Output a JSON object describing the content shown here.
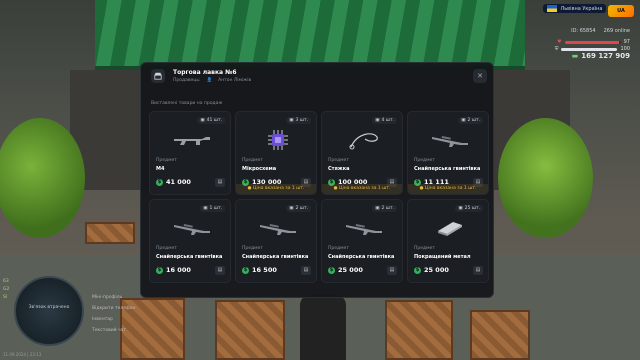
{
  "hud": {
    "server": "Львівна Україна",
    "id_label": "ID: 65854",
    "online": "269 online",
    "hp": "97",
    "armor": "100",
    "money": "169 127 909"
  },
  "minimap": {
    "text": "Зв'язок втрачено",
    "date": "11.09.2024 | 23:13"
  },
  "side_stats": [
    "63",
    "G2",
    "SI"
  ],
  "side_menu": [
    "Міні-профіль",
    "Відкрити телефон",
    "Інвентар",
    "Текстовий чат"
  ],
  "shop": {
    "title": "Торгова лавка №6",
    "subtitle_kind": "Продавець:",
    "seller": "Антон Ліміжів",
    "section": "Виставлені товари на продаж",
    "note": "Ціна вказана за 1 шт.",
    "items": [
      {
        "qty": "41 шт.",
        "kind": "Предмет",
        "name": "M4",
        "price": "41 000",
        "note": false,
        "icon": "rifle-icon"
      },
      {
        "qty": "3 шт.",
        "kind": "Предмет",
        "name": "Мікросхема",
        "price": "130 000",
        "note": true,
        "icon": "chip-icon"
      },
      {
        "qty": "4 шт.",
        "kind": "Предмет",
        "name": "Стяжка",
        "price": "100 000",
        "note": true,
        "icon": "zip-tie-icon"
      },
      {
        "qty": "2 шт.",
        "kind": "Предмет",
        "name": "Снайперська гвинтівка",
        "price": "11 111",
        "note": true,
        "icon": "sniper-icon"
      },
      {
        "qty": "1 шт.",
        "kind": "Предмет",
        "name": "Снайперська гвинтівка",
        "price": "16 000",
        "note": false,
        "icon": "sniper-icon"
      },
      {
        "qty": "2 шт.",
        "kind": "Предмет",
        "name": "Снайперська гвинтівка",
        "price": "16 500",
        "note": false,
        "icon": "sniper-icon"
      },
      {
        "qty": "2 шт.",
        "kind": "Предмет",
        "name": "Снайперська гвинтівка",
        "price": "25 000",
        "note": false,
        "icon": "sniper-icon"
      },
      {
        "qty": "25 шт.",
        "kind": "Предмет",
        "name": "Покращений метал",
        "price": "25 000",
        "note": false,
        "icon": "metal-icon"
      }
    ]
  },
  "colors": {
    "accent": "#2fb45a",
    "note": "#e7b83a",
    "hp": "#e0464e",
    "armor": "#dfe3ea"
  },
  "progress": {
    "hp": 0.97,
    "armor": 1.0
  }
}
